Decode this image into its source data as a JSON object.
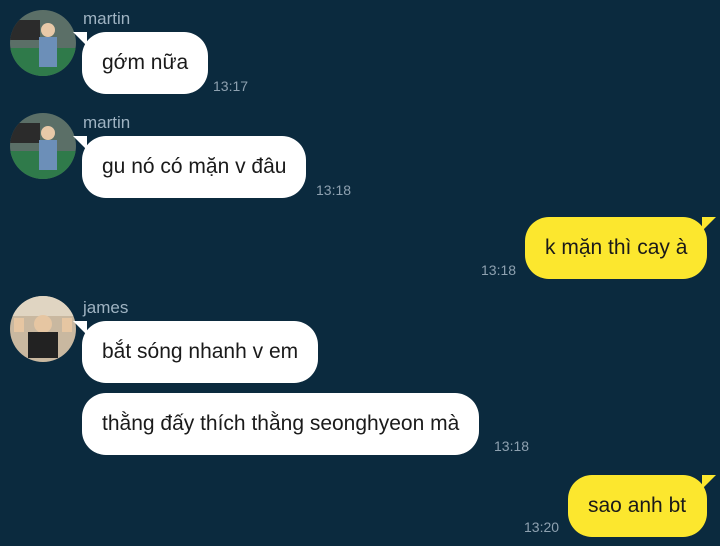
{
  "messages": [
    {
      "sender": "martin",
      "text": "gớm nữa",
      "time": "13:17"
    },
    {
      "sender": "martin",
      "text": "gu nó có mặn v đâu",
      "time": "13:18"
    },
    {
      "sender": "me",
      "text": "k mặn thì cay à",
      "time": "13:18"
    },
    {
      "sender": "james",
      "text": "bắt sóng nhanh v em",
      "time": ""
    },
    {
      "sender": "james",
      "text": "thằng đấy thích thằng seonghyeon mà",
      "time": "13:18"
    },
    {
      "sender": "me",
      "text": "sao anh bt",
      "time": "13:20"
    }
  ],
  "colors": {
    "background": "#0b2a3e",
    "incoming": "#ffffff",
    "outgoing": "#fce72e"
  },
  "icons": {
    "martin": "avatar-photo",
    "james": "avatar-photo"
  }
}
